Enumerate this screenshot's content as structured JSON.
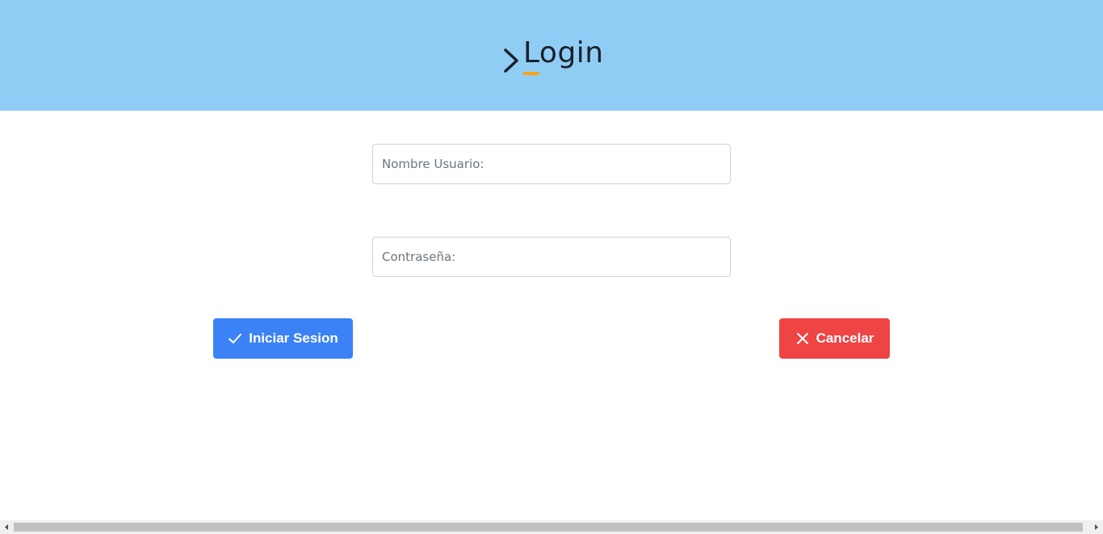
{
  "header": {
    "title": "Login",
    "background_color": "#90cdf4",
    "cursor_color": "#f6a51a"
  },
  "form": {
    "username": {
      "placeholder": "Nombre Usuario:",
      "value": ""
    },
    "password": {
      "placeholder": "Contraseña:",
      "value": ""
    }
  },
  "buttons": {
    "login": {
      "label": "Iniciar Sesion",
      "icon": "check-icon",
      "color": "#3b82f6"
    },
    "cancel": {
      "label": "Cancelar",
      "icon": "close-icon",
      "color": "#ef4444"
    }
  },
  "scrollbar": {
    "orientation": "horizontal"
  }
}
